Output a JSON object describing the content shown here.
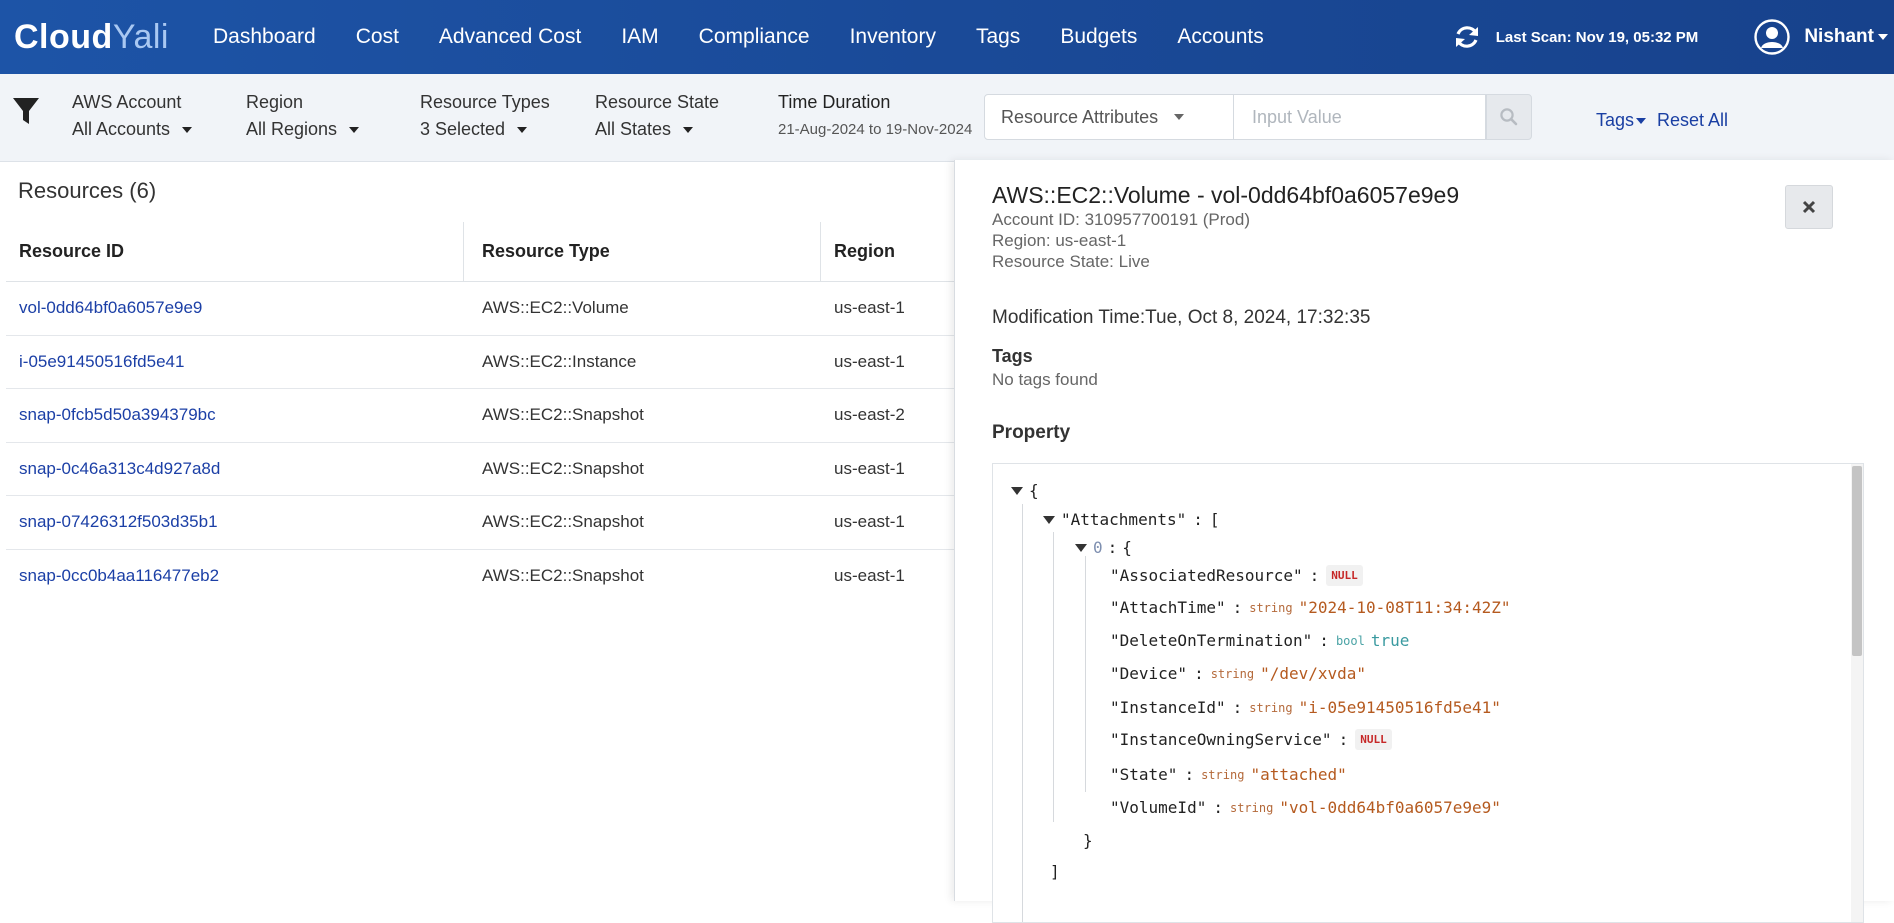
{
  "app": {
    "logo_part1": "Cloud",
    "logo_part2": "Yali",
    "nav": [
      "Dashboard",
      "Cost",
      "Advanced Cost",
      "IAM",
      "Compliance",
      "Inventory",
      "Tags",
      "Budgets",
      "Accounts"
    ],
    "last_scan": "Last Scan: Nov 19, 05:32 PM",
    "user_name": "Nishant"
  },
  "filters": {
    "aws_account": {
      "label": "AWS Account",
      "value": "All Accounts"
    },
    "region": {
      "label": "Region",
      "value": "All Regions"
    },
    "resource_types": {
      "label": "Resource Types",
      "value": "3 Selected"
    },
    "resource_state": {
      "label": "Resource State",
      "value": "All States"
    },
    "time_duration": {
      "label": "Time Duration",
      "value": "21-Aug-2024 to 19-Nov-2024"
    },
    "attribute_select": "Resource Attributes",
    "attribute_input_placeholder": "Input Value",
    "tags_label": "Tags",
    "reset_label": "Reset All"
  },
  "resources": {
    "title": "Resources (6)",
    "columns": [
      "Resource ID",
      "Resource Type",
      "Region"
    ],
    "rows": [
      [
        "vol-0dd64bf0a6057e9e9",
        "AWS::EC2::Volume",
        "us-east-1"
      ],
      [
        "i-05e91450516fd5e41",
        "AWS::EC2::Instance",
        "us-east-1"
      ],
      [
        "snap-0fcb5d50a394379bc",
        "AWS::EC2::Snapshot",
        "us-east-2"
      ],
      [
        "snap-0c46a313c4d927a8d",
        "AWS::EC2::Snapshot",
        "us-east-1"
      ],
      [
        "snap-07426312f503d35b1",
        "AWS::EC2::Snapshot",
        "us-east-1"
      ],
      [
        "snap-0cc0b4aa116477eb2",
        "AWS::EC2::Snapshot",
        "us-east-1"
      ]
    ]
  },
  "detail": {
    "title": "AWS::EC2::Volume - vol-0dd64bf0a6057e9e9",
    "account": "Account ID: 310957700191 (Prod)",
    "region": "Region: us-east-1",
    "state": "Resource State: Live",
    "modification_time": "Modification Time:Tue, Oct 8, 2024, 17:32:35",
    "tags_heading": "Tags",
    "tags_value": "No tags found",
    "property_heading": "Property",
    "json": {
      "open_brace": "{",
      "attachments_key": "\"Attachments\"",
      "open_bracket": "[",
      "index": "0",
      "fields": [
        {
          "key": "\"AssociatedResource\"",
          "type": "",
          "value": "NULL",
          "kind": "null"
        },
        {
          "key": "\"AttachTime\"",
          "type": "string",
          "value": "\"2024-10-08T11:34:42Z\"",
          "kind": "string"
        },
        {
          "key": "\"DeleteOnTermination\"",
          "type": "bool",
          "value": "true",
          "kind": "bool"
        },
        {
          "key": "\"Device\"",
          "type": "string",
          "value": "\"/dev/xvda\"",
          "kind": "string"
        },
        {
          "key": "\"InstanceId\"",
          "type": "string",
          "value": "\"i-05e91450516fd5e41\"",
          "kind": "string"
        },
        {
          "key": "\"InstanceOwningService\"",
          "type": "",
          "value": "NULL",
          "kind": "null"
        },
        {
          "key": "\"State\"",
          "type": "string",
          "value": "\"attached\"",
          "kind": "string"
        },
        {
          "key": "\"VolumeId\"",
          "type": "string",
          "value": "\"vol-0dd64bf0a6057e9e9\"",
          "kind": "string"
        }
      ],
      "close_brace": "}",
      "close_bracket": "]"
    }
  },
  "colors": {
    "nav_bg": "#1d54a7",
    "link_blue": "#1b3fa6",
    "json_string": "#b55a1f",
    "json_null": "#c62828",
    "json_bool": "#3a9aa0"
  }
}
